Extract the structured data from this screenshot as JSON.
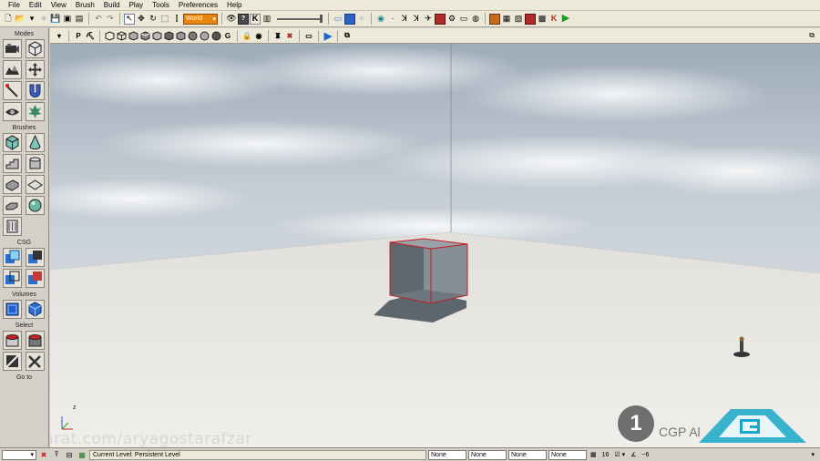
{
  "menu": [
    "File",
    "Edit",
    "View",
    "Brush",
    "Build",
    "Play",
    "Tools",
    "Preferences",
    "Help"
  ],
  "toolbar": {
    "coord_system": "World",
    "coord_system_arrow": "▾"
  },
  "modes_panel": {
    "sections": {
      "modes": "Modes",
      "brushes": "Brushes",
      "csg": "CSG",
      "volumes": "Volumes",
      "select": "Select",
      "goto": "Go to"
    }
  },
  "viewport_toolbar": {
    "perspective_label": "P",
    "game_label": "G",
    "maximize_glyph": "⧉"
  },
  "viewport": {
    "axis_label": "z",
    "overlay_number": "1",
    "overlay_brand": "CGP Al",
    "watermark": "Sarat.com/aryagostarafzar"
  },
  "statusbar": {
    "current_level": "Current Level:  Persistent Level",
    "fields": [
      "None",
      "None",
      "None",
      "None"
    ],
    "grid_size": "16",
    "rotation_snap": "~6",
    "dropdown_arrow": "▾"
  },
  "colors": {
    "ui_bg": "#d4d0c8",
    "toolbar_bg": "#ece9d8",
    "world_orange": "#e9860f",
    "sky_top": "#9eabb9",
    "floor": "#ebe8e2",
    "brush_red": "#c02020"
  }
}
